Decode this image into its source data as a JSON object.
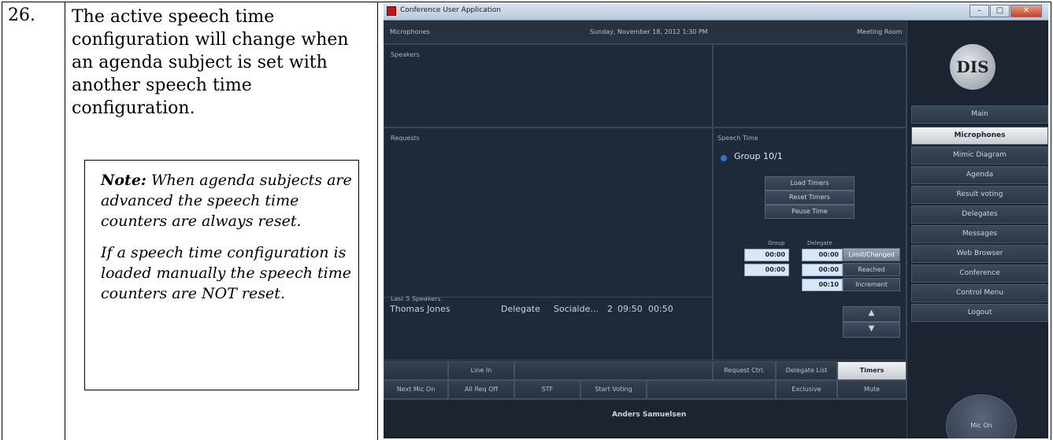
{
  "step": {
    "number": "26.",
    "text": "The active speech time configuration will change when an agenda subject is set with another speech time configuration."
  },
  "note": {
    "label": "Note:",
    "text1": "When agenda subjects are advanced the speech time counters are always reset.",
    "text2": "If a speech time configuration is loaded manually the speech time counters are NOT reset."
  },
  "app": {
    "window_title": "Conference User Application",
    "header": {
      "left": "Microphones",
      "center": "Sunday, November 18, 2012 1:30 PM",
      "right": "Meeting Room"
    },
    "panels": {
      "speakers": "Speakers",
      "requests": "Requests",
      "speech_time": "Speech Time",
      "last5": "Last 5 Speakers"
    },
    "group_label": "Group 10/1",
    "speech_buttons": [
      "Load Timers",
      "Reset Timers",
      "Pause Time"
    ],
    "timers": {
      "group_header": "Group",
      "delegate_header": "Delegate",
      "rows": [
        {
          "group": "00:00",
          "delegate": "00:00",
          "label": "Limit/Changed"
        },
        {
          "group": "00:00",
          "delegate": "00:00",
          "label": "Reached"
        },
        {
          "group": "",
          "delegate": "00:10",
          "label": "Increment"
        }
      ]
    },
    "last_speaker": {
      "name": "Thomas Jones",
      "role": "Delegate",
      "party": "Socialde...",
      "count": "2",
      "time": "09:50",
      "duration": "00:50"
    },
    "logo_text": "DIS",
    "menu": [
      {
        "label": "Main",
        "active": false
      },
      {
        "label": "Microphones",
        "active": true
      },
      {
        "label": "Mimic Diagram",
        "active": false
      },
      {
        "label": "Agenda",
        "active": false
      },
      {
        "label": "Result voting",
        "active": false
      },
      {
        "label": "Delegates",
        "active": false
      },
      {
        "label": "Messages",
        "active": false
      },
      {
        "label": "Web Browser",
        "active": false
      },
      {
        "label": "Conference",
        "active": false
      },
      {
        "label": "Control Menu",
        "active": false
      },
      {
        "label": "Logout",
        "active": false
      }
    ],
    "bottom_row1": [
      "",
      "Line In",
      "",
      "Request Ctrl.",
      "Delegate List",
      "Timers"
    ],
    "bottom_row2": [
      "Next Mic On",
      "All Req Off",
      "STF",
      "Start Voting",
      "",
      "Exclusive",
      "Mute"
    ],
    "user_name": "Anders Samuelsen",
    "mic_on": "Mic On",
    "arrow_up": "▲",
    "arrow_down": "▼"
  }
}
